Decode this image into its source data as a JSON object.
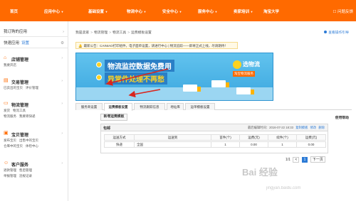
{
  "topnav": {
    "items": [
      "首页",
      "应用中心",
      "基础设置",
      "物流中心",
      "安全中心",
      "服务中心",
      "卖家培训",
      "淘宝大学"
    ],
    "help": "问题反馈"
  },
  "sidebar": {
    "apps_label": "我订购的应用",
    "quick_label": "快速应用",
    "quick_setting": "设置",
    "groups": [
      {
        "title": "店铺管理",
        "links": [
          "我要开店"
        ]
      },
      {
        "title": "交易管理",
        "links": [
          "已卖出的宝贝",
          "评价管理"
        ]
      },
      {
        "title": "物流管理",
        "links": [
          "发货",
          "物流工具"
        ],
        "links2": [
          "物流服务",
          "我要寄快递"
        ]
      },
      {
        "title": "宝贝管理",
        "links": [
          "发布宝贝",
          "出售中的宝贝"
        ],
        "links2": [
          "仓库中的宝贝",
          "体检中心"
        ]
      },
      {
        "title": "客户服务",
        "links": [
          "退款管理",
          "售后管理"
        ],
        "links2": [
          "举报管理",
          "违规记录"
        ]
      }
    ]
  },
  "breadcrumb": [
    "我是卖家",
    "物流管理",
    "物流工具",
    "运费模板设置"
  ],
  "view_guide": "查看操作引导",
  "notice": "最新公告：CAINIAO打印组件，电子面单设置，请进行中心 | 物流追踪——即将正式上线，尽请期待！",
  "banner": {
    "line1": "物流监控数据免费用",
    "line2": "异常件处理不再愁",
    "brand": "选物流",
    "brand_tag": "淘宝物流服务"
  },
  "tabs": [
    "服务商设置",
    "运费模板设置",
    "物流跟踪信息",
    "地址库",
    "运单模板设置"
  ],
  "active_tab": 1,
  "new_template_button": "新增运费模板",
  "help_link": "使用帮助",
  "template": {
    "name": "包邮",
    "updated_label": "最后编辑时间：",
    "updated_time": "2016-07-22 18:33",
    "actions": [
      "复制模板",
      "修改",
      "删除"
    ],
    "headers": [
      "运送方式",
      "运送到",
      "首件(个)",
      "运费(元)",
      "续件(个)",
      "运费(元)"
    ],
    "rows": [
      [
        "快递",
        "全国",
        "1",
        "0.00",
        "1",
        "0.00"
      ]
    ]
  },
  "pager": {
    "summary": "1/1",
    "prev": "<",
    "current": "1",
    "next": "下一页"
  },
  "watermark": "Bai 经验",
  "watermark_url": "jingyan.baidu.com",
  "colors": {
    "brand": "#ff6a00",
    "link": "#2c7bd6",
    "annotation": "#d9251d"
  }
}
